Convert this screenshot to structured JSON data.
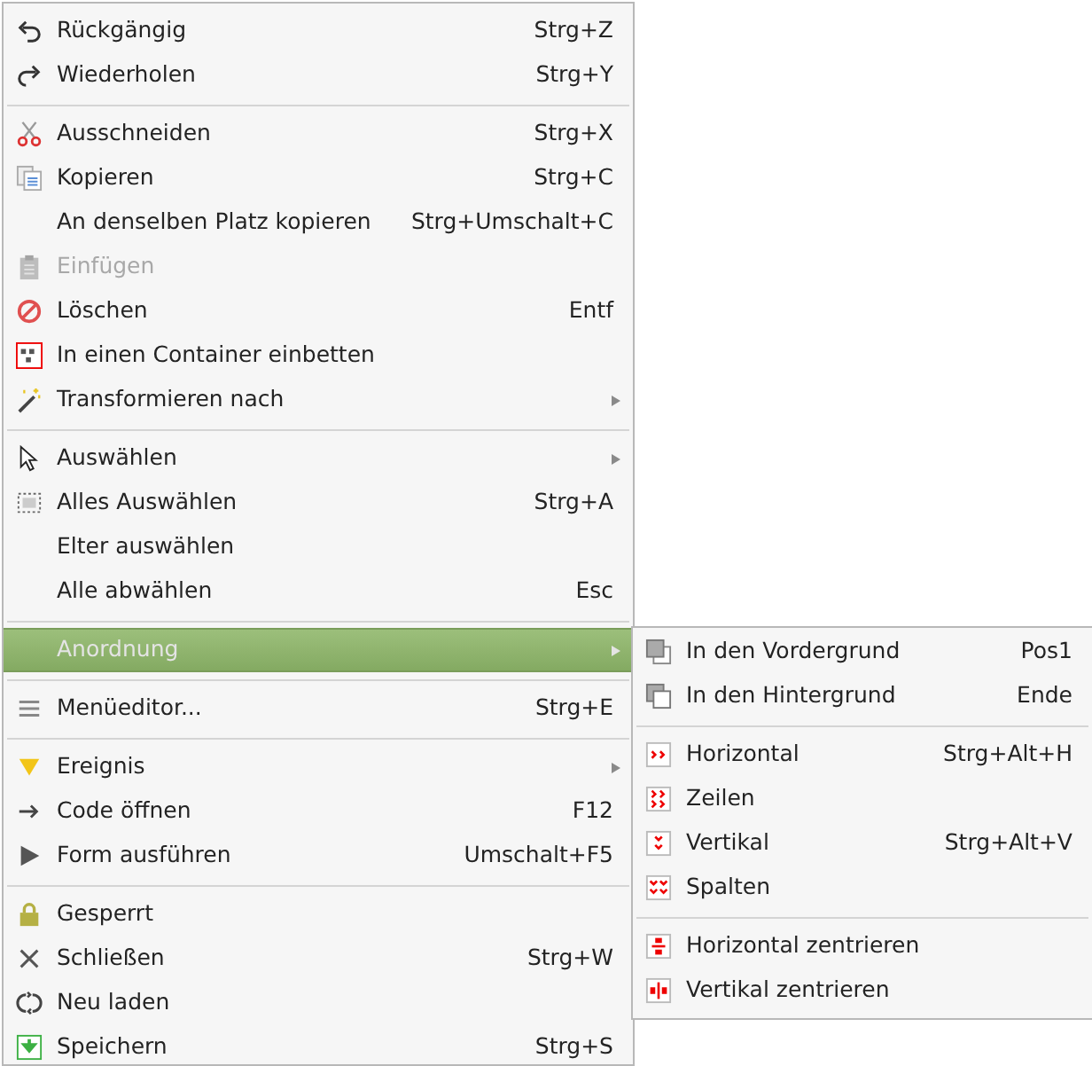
{
  "menu": {
    "groups": [
      [
        {
          "label": "Rückgängig",
          "shortcut": "Strg+Z",
          "disabled": false,
          "selected": false,
          "has_submenu": false
        },
        {
          "label": "Wiederholen",
          "shortcut": "Strg+Y",
          "disabled": false,
          "selected": false,
          "has_submenu": false
        }
      ],
      [
        {
          "label": "Ausschneiden",
          "shortcut": "Strg+X",
          "disabled": false,
          "selected": false,
          "has_submenu": false
        },
        {
          "label": "Kopieren",
          "shortcut": "Strg+C",
          "disabled": false,
          "selected": false,
          "has_submenu": false
        },
        {
          "label": "An denselben Platz kopieren",
          "shortcut": "Strg+Umschalt+C",
          "disabled": false,
          "selected": false,
          "has_submenu": false
        },
        {
          "label": "Einfügen",
          "disabled": true,
          "selected": false,
          "has_submenu": false
        },
        {
          "label": "Löschen",
          "shortcut": "Entf",
          "disabled": false,
          "selected": false,
          "has_submenu": false
        },
        {
          "label": "In einen Container einbetten",
          "disabled": false,
          "selected": false,
          "has_submenu": false
        },
        {
          "label": "Transformieren nach",
          "disabled": false,
          "selected": false,
          "has_submenu": true
        }
      ],
      [
        {
          "label": "Auswählen",
          "disabled": false,
          "selected": false,
          "has_submenu": true
        },
        {
          "label": "Alles Auswählen",
          "shortcut": "Strg+A",
          "disabled": false,
          "selected": false,
          "has_submenu": false
        },
        {
          "label": "Elter auswählen",
          "disabled": false,
          "selected": false,
          "has_submenu": false
        },
        {
          "label": "Alle abwählen",
          "shortcut": "Esc",
          "disabled": false,
          "selected": false,
          "has_submenu": false
        }
      ],
      [
        {
          "label": "Anordnung",
          "disabled": false,
          "selected": true,
          "has_submenu": true
        }
      ],
      [
        {
          "label": "Menüeditor...",
          "shortcut": "Strg+E",
          "disabled": false,
          "selected": false,
          "has_submenu": false
        }
      ],
      [
        {
          "label": "Ereignis",
          "disabled": false,
          "selected": false,
          "has_submenu": true
        },
        {
          "label": "Code öffnen",
          "shortcut": "F12",
          "disabled": false,
          "selected": false,
          "has_submenu": false
        },
        {
          "label": "Form ausführen",
          "shortcut": "Umschalt+F5",
          "disabled": false,
          "selected": false,
          "has_submenu": false
        }
      ],
      [
        {
          "label": "Gesperrt",
          "disabled": false,
          "selected": false,
          "has_submenu": false
        },
        {
          "label": "Schließen",
          "shortcut": "Strg+W",
          "disabled": false,
          "selected": false,
          "has_submenu": false
        },
        {
          "label": "Neu laden",
          "disabled": false,
          "selected": false,
          "has_submenu": false
        },
        {
          "label": "Speichern",
          "shortcut": "Strg+S",
          "disabled": false,
          "selected": false,
          "has_submenu": false
        }
      ]
    ]
  },
  "submenu": {
    "groups": [
      [
        {
          "label": "In den Vordergrund",
          "shortcut": "Pos1",
          "disabled": false,
          "selected": false,
          "has_submenu": false
        },
        {
          "label": "In den Hintergrund",
          "shortcut": "Ende",
          "disabled": false,
          "selected": false,
          "has_submenu": false
        }
      ],
      [
        {
          "label": "Horizontal",
          "shortcut": "Strg+Alt+H",
          "disabled": false,
          "selected": false,
          "has_submenu": false
        },
        {
          "label": "Zeilen",
          "disabled": false,
          "selected": false,
          "has_submenu": false
        },
        {
          "label": "Vertikal",
          "shortcut": "Strg+Alt+V",
          "disabled": false,
          "selected": false,
          "has_submenu": false
        },
        {
          "label": "Spalten",
          "disabled": false,
          "selected": false,
          "has_submenu": false
        }
      ],
      [
        {
          "label": "Horizontal zentrieren",
          "disabled": false,
          "selected": false,
          "has_submenu": false
        },
        {
          "label": "Vertikal zentrieren",
          "disabled": false,
          "selected": false,
          "has_submenu": false
        }
      ]
    ]
  }
}
